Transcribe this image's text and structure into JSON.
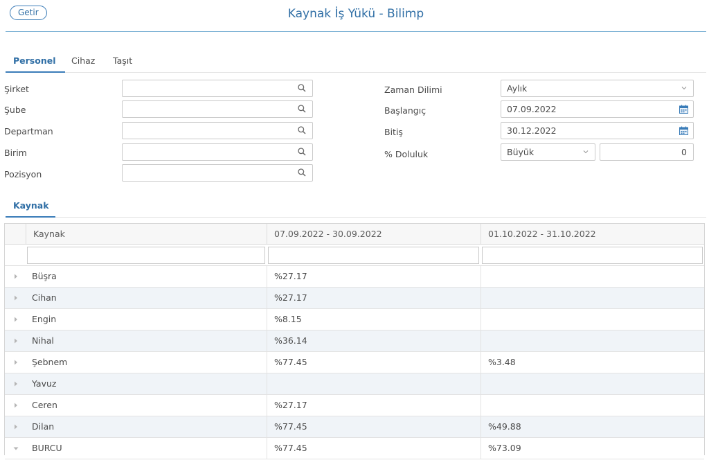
{
  "header": {
    "getir_label": "Getir",
    "title": "Kaynak İş Yükü - Bilimp"
  },
  "tabs": [
    {
      "label": "Personel",
      "active": true
    },
    {
      "label": "Cihaz",
      "active": false
    },
    {
      "label": "Taşıt",
      "active": false
    }
  ],
  "filters": {
    "sirket_label": "Şirket",
    "sube_label": "Şube",
    "departman_label": "Departman",
    "birim_label": "Birim",
    "pozisyon_label": "Pozisyon",
    "zaman_dilimi_label": "Zaman Dilimi",
    "zaman_dilimi_value": "Aylık",
    "baslangic_label": "Başlangıç",
    "baslangic_value": "07.09.2022",
    "bitis_label": "Bitiş",
    "bitis_value": "30.12.2022",
    "doluluk_label": "% Doluluk",
    "doluluk_operator": "Büyük",
    "doluluk_value": "0"
  },
  "section": {
    "title": "Kaynak"
  },
  "grid": {
    "columns": [
      "Kaynak",
      "07.09.2022 - 30.09.2022",
      "01.10.2022 - 31.10.2022"
    ],
    "rows": [
      {
        "name": "Büşra",
        "p1": "%27.17",
        "p2": "",
        "expanded": false
      },
      {
        "name": "Cihan",
        "p1": "%27.17",
        "p2": "",
        "expanded": false
      },
      {
        "name": "Engin",
        "p1": "%8.15",
        "p2": "",
        "expanded": false
      },
      {
        "name": "Nihal",
        "p1": "%36.14",
        "p2": "",
        "expanded": false
      },
      {
        "name": "Şebnem",
        "p1": "%77.45",
        "p2": "%3.48",
        "expanded": false
      },
      {
        "name": "Yavuz",
        "p1": "",
        "p2": "",
        "expanded": false
      },
      {
        "name": "Ceren",
        "p1": "%27.17",
        "p2": "",
        "expanded": false
      },
      {
        "name": "Dilan",
        "p1": "%77.45",
        "p2": "%49.88",
        "expanded": false
      },
      {
        "name": "BURCU",
        "p1": "%77.45",
        "p2": "%73.09",
        "expanded": true
      }
    ]
  },
  "colors": {
    "accent": "#2f6ea5",
    "row_alt": "#f0f4f8",
    "border": "#c9c9c9"
  },
  "icons": {
    "lookup": "search-icon",
    "select": "chevron-down-icon",
    "date": "calendar-icon",
    "row_collapsed": "caret-right-icon",
    "row_expanded": "caret-down-icon"
  }
}
